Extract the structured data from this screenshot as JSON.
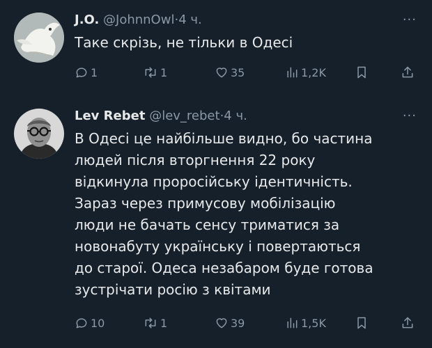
{
  "tweets": [
    {
      "name": "J.O.",
      "handle": "@JohnnOwl",
      "time": "4 ч.",
      "more": "···",
      "text": "Таке скрізь, не тільки в Одесі",
      "stats": {
        "replies": "1",
        "retweets": "1",
        "likes": "35",
        "views": "1,2K"
      }
    },
    {
      "name": "Lev Rebet",
      "handle": "@lev_rebet",
      "time": "4 ч.",
      "more": "···",
      "text": "В Одесі це найбільше видно, бо частина\nлюдей після  вторгнення 22 року\nвідкинула проросійську ідентичність.\nЗараз через примусову мобілізацію\nлюди не бачать сенсу триматися за\nновонабуту українську і повертаються\nдо старої. Одеса незабаром буде готова\nзустрічати росію з квітами",
      "stats": {
        "replies": "10",
        "retweets": "1",
        "likes": "39",
        "views": "1,5K"
      }
    }
  ],
  "colors": {
    "background": "#15202b",
    "text": "#e7e9ea",
    "muted": "#8b98a5"
  },
  "icons": [
    "reply-icon",
    "retweet-icon",
    "like-icon",
    "views-icon",
    "bookmark-icon",
    "share-icon",
    "more-icon"
  ]
}
